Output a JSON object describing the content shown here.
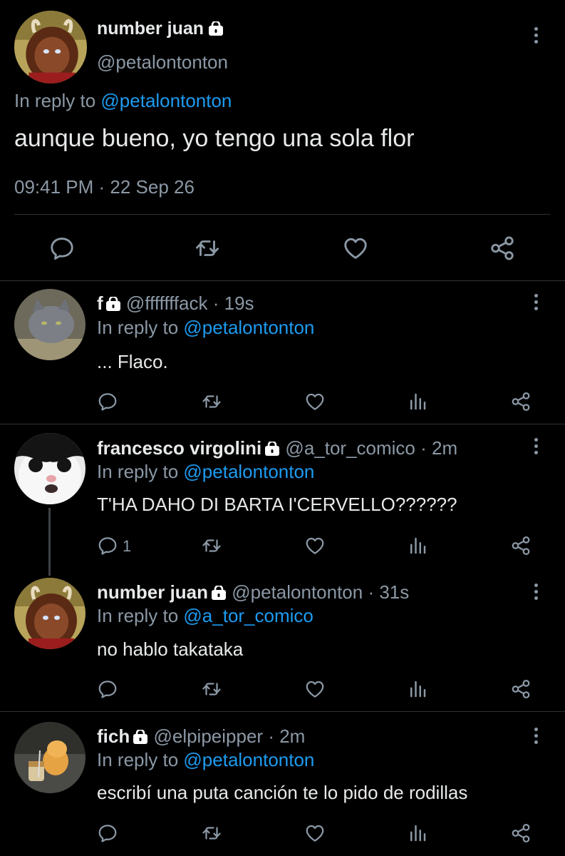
{
  "main_tweet": {
    "name": "number juan",
    "handle": "@petalontonton",
    "reply_prefix": "In reply to",
    "reply_to": "@petalontonton",
    "text": "aunque bueno, yo tengo una sola flor",
    "timestamp": "09:41 PM · 22 Sep 26"
  },
  "replies": [
    {
      "name": "f",
      "handle": "@fffffffack",
      "time": "· 19s",
      "reply_prefix": "In reply to",
      "reply_to": "@petalontonton",
      "text": "... Flaco.",
      "reply_count": ""
    },
    {
      "name": "francesco virgolini",
      "handle": "@a_tor_comico",
      "time": "· 2m",
      "reply_prefix": "In reply to",
      "reply_to": "@petalontonton",
      "text": "T'HA DAHO DI BARTA I'CERVELLO??????",
      "reply_count": "1"
    },
    {
      "name": "number juan",
      "handle": "@petalontonton",
      "time": "· 31s",
      "reply_prefix": "In reply to",
      "reply_to": "@a_tor_comico",
      "text": "no hablo takataka",
      "reply_count": ""
    },
    {
      "name": "fich",
      "handle": "@elpipeipper",
      "time": "· 2m",
      "reply_prefix": "In reply to",
      "reply_to": "@petalontonton",
      "text": "escribí una puta canción te lo pido de rodillas",
      "reply_count": ""
    }
  ],
  "colors": {
    "background": "#000000",
    "text": "#e7e9ea",
    "secondary": "#8b98a5",
    "link": "#1d9bf0",
    "divider": "#2f3336"
  },
  "icons": [
    "lock-icon",
    "more-options-icon",
    "reply-icon",
    "retweet-icon",
    "like-icon",
    "views-icon",
    "share-icon"
  ]
}
